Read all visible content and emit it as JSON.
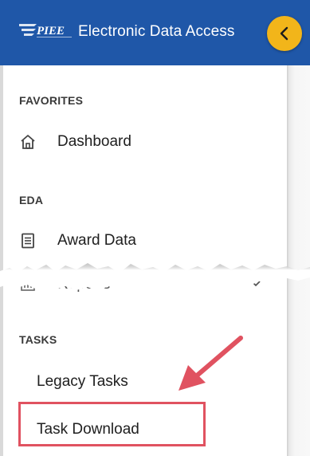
{
  "header": {
    "logo_text": "PIEE",
    "title": "Electronic Data Access",
    "collapse_icon": "chevron-left-icon",
    "background": "#1f57a8",
    "collapse_color": "#f2b51a"
  },
  "sidebar": {
    "favorites": {
      "heading": "FAVORITES",
      "items": [
        {
          "label": "Dashboard",
          "icon": "home-icon"
        }
      ]
    },
    "eda": {
      "heading": "EDA",
      "items": [
        {
          "label": "Award Data",
          "icon": "document-icon"
        },
        {
          "label": "Reports",
          "icon": "report-icon",
          "expandable": true
        }
      ]
    },
    "tasks": {
      "heading": "TASKS",
      "items": [
        {
          "label": "Legacy Tasks"
        },
        {
          "label": "Task Download",
          "highlighted": true
        }
      ]
    }
  },
  "annotation": {
    "color": "#e05260",
    "arrow_icon": "arrow-icon"
  }
}
